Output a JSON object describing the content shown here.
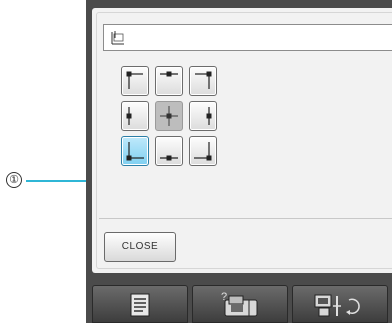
{
  "callout": {
    "number": "①"
  },
  "buttons": {
    "close_label": "CLOSE"
  },
  "position_grid": [
    {
      "id": "top-left"
    },
    {
      "id": "top-center"
    },
    {
      "id": "top-right"
    },
    {
      "id": "middle-left"
    },
    {
      "id": "center",
      "state": "disabled"
    },
    {
      "id": "middle-right"
    },
    {
      "id": "bottom-left",
      "state": "selected"
    },
    {
      "id": "bottom-center"
    },
    {
      "id": "bottom-right"
    }
  ],
  "bottom_bar": {
    "items": [
      {
        "icon": "document-list-icon"
      },
      {
        "icon": "help-sewing-machine-icon",
        "label": "?"
      },
      {
        "icon": "embroidery-unit-icon"
      }
    ]
  },
  "colors": {
    "selected": "#7fd0f1",
    "callout_line": "#2fb6d6",
    "frame": "#4b4b4b"
  }
}
